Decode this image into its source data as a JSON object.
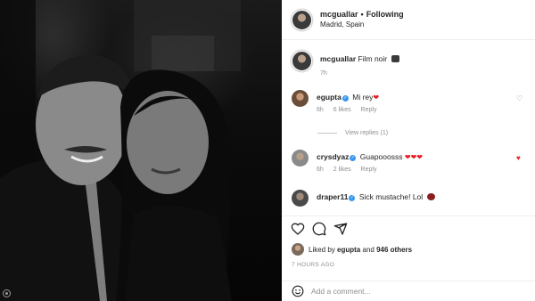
{
  "header": {
    "username": "mcguallar",
    "separator": "•",
    "follow_label": "Following",
    "location": "Madrid, Spain"
  },
  "caption": {
    "username": "mcguallar",
    "text": "Film noir",
    "time": "7h"
  },
  "comments": [
    {
      "username": "egupta",
      "verified": true,
      "text": "Mi rey",
      "time": "6h",
      "likes": "6 likes",
      "reply_label": "Reply"
    },
    {
      "username": "crysdyaz",
      "verified": true,
      "text": "Guapooosss",
      "time": "6h",
      "likes": "2 likes",
      "reply_label": "Reply"
    },
    {
      "username": "draper11",
      "verified": true,
      "text": "Sick mustache! Lol"
    }
  ],
  "view_replies": "View replies (1)",
  "actions": {
    "like_icon": "heart-icon",
    "comment_icon": "comment-icon",
    "share_icon": "share-icon"
  },
  "liked_by": {
    "prefix": "Liked by",
    "user": "egupta",
    "conjunction": "and",
    "others": "946 others"
  },
  "time_ago": "7 HOURS AGO",
  "add_comment": {
    "placeholder": "Add a comment..."
  },
  "colors": {
    "verified": "#3897f0",
    "heart": "#ed1c24",
    "muted": "#8e8e8e",
    "text": "#262626"
  }
}
